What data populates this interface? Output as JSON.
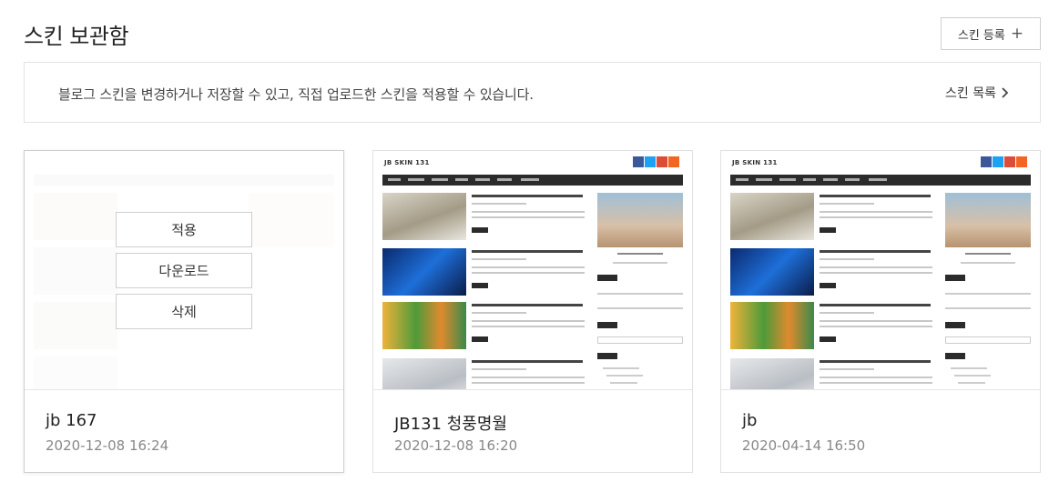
{
  "header": {
    "title": "스킨 보관함",
    "register_label": "스킨 등록",
    "register_icon": "plus-icon"
  },
  "notice": {
    "text": "블로그 스킨을 변경하거나 저장할 수 있고, 직접 업로드한 스킨을 적용할 수 있습니다.",
    "link_label": "스킨 목록",
    "link_icon": "chevron-right-icon"
  },
  "cards": [
    {
      "name": "jb 167",
      "date": "2020-12-08 16:24",
      "hovered": true,
      "actions": [
        "적용",
        "다운로드",
        "삭제"
      ],
      "thumb_logo": ""
    },
    {
      "name": "JB131 청풍명월",
      "date": "2020-12-08 16:20",
      "hovered": false,
      "thumb_logo": "JB SKIN 131"
    },
    {
      "name": "jb",
      "date": "2020-04-14 16:50",
      "hovered": false,
      "thumb_logo": "JB SKIN 131"
    }
  ],
  "colors": {
    "facebook": "#3b5998",
    "twitter": "#1da1f2",
    "google": "#dd4b39",
    "rss": "#f26522",
    "nav_bg": "#2b2b2b"
  }
}
